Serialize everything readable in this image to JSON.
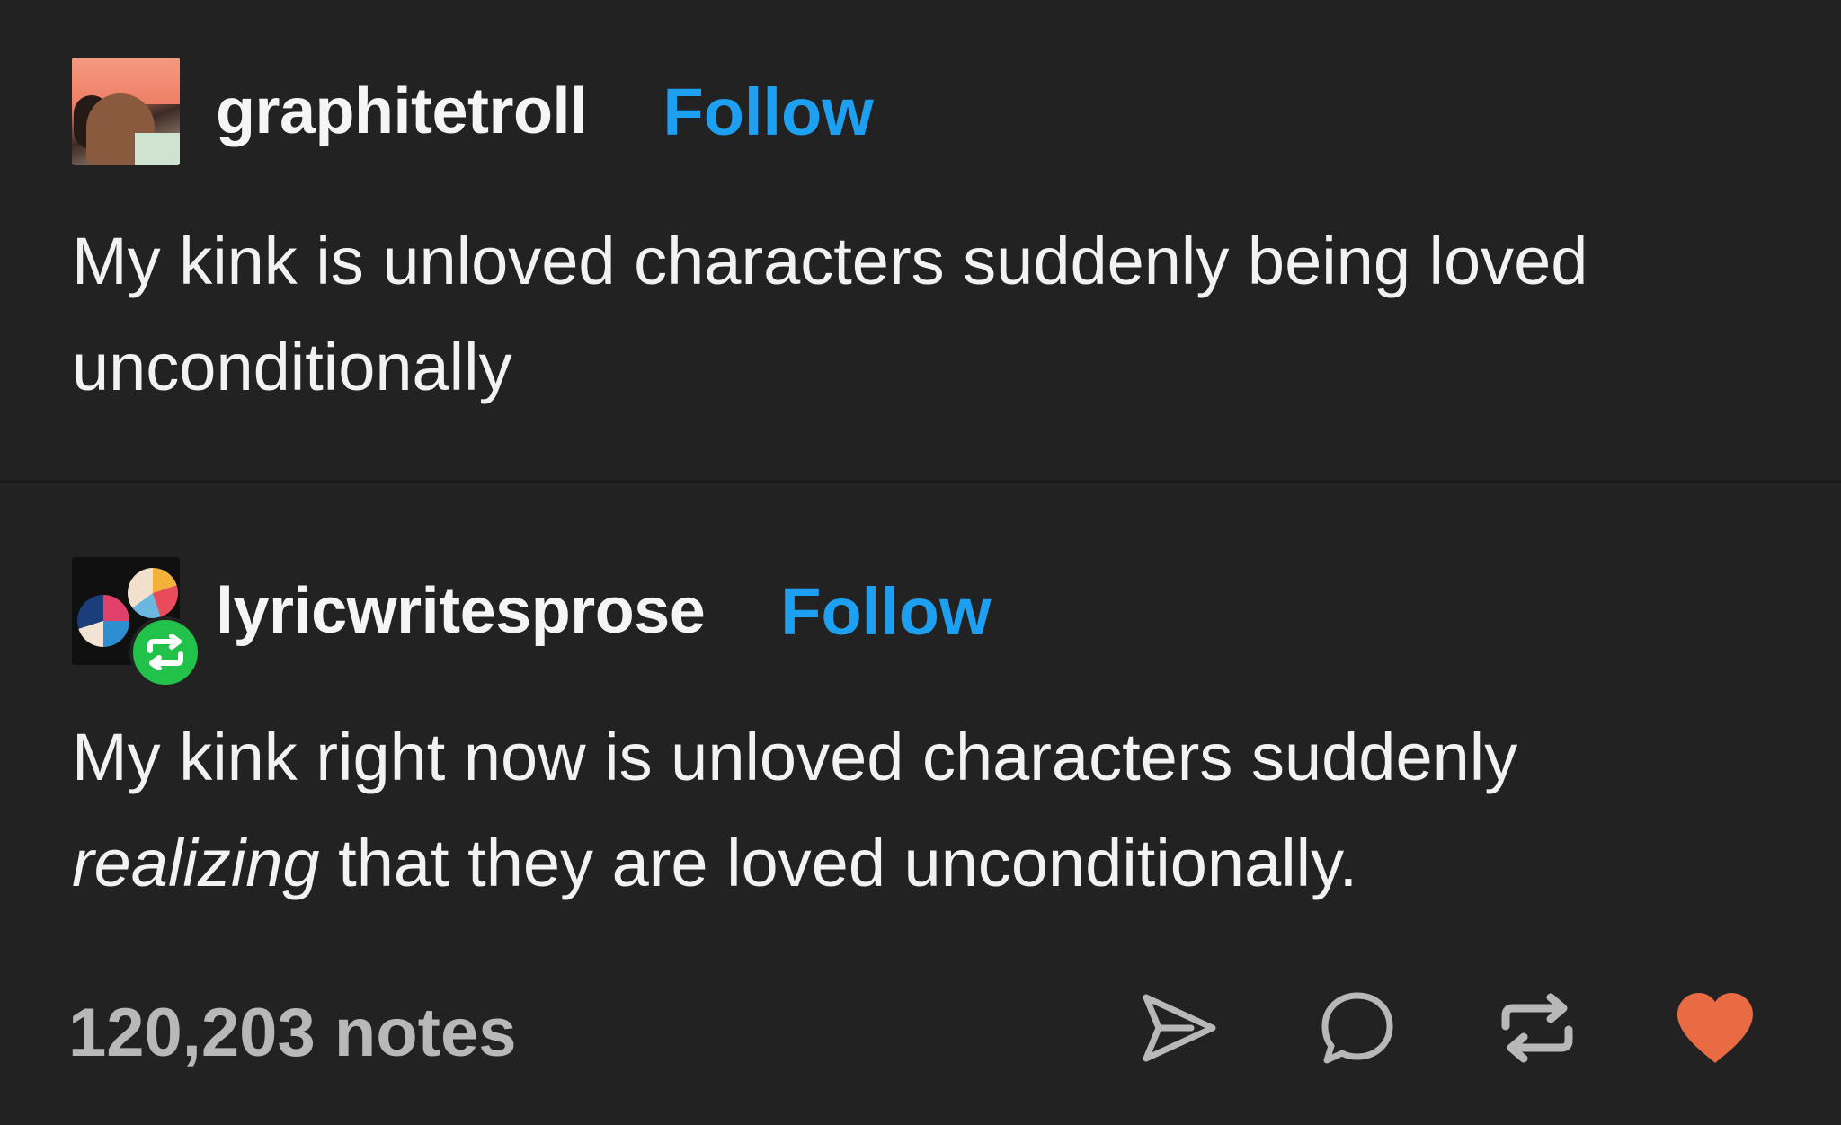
{
  "posts": [
    {
      "username": "graphitetroll",
      "follow_label": "Follow",
      "text": "My kink is unloved characters suddenly being loved unconditionally"
    },
    {
      "username": "lyricwritesprose",
      "follow_label": "Follow",
      "text_before": "My kink right now is unloved characters suddenly ",
      "text_emphasis": "realizing",
      "text_after": " that they are loved unconditionally."
    }
  ],
  "footer": {
    "notes": "120,203 notes"
  },
  "icons": {
    "share": "share-icon",
    "reply": "reply-icon",
    "reblog": "reblog-icon",
    "like": "heart-icon",
    "reblog_badge": "reblog-badge-icon"
  },
  "colors": {
    "background": "#222222",
    "follow": "#1da0f2",
    "reblog_badge": "#22c24a",
    "like": "#e86b43",
    "notes": "#b8b8b8"
  }
}
